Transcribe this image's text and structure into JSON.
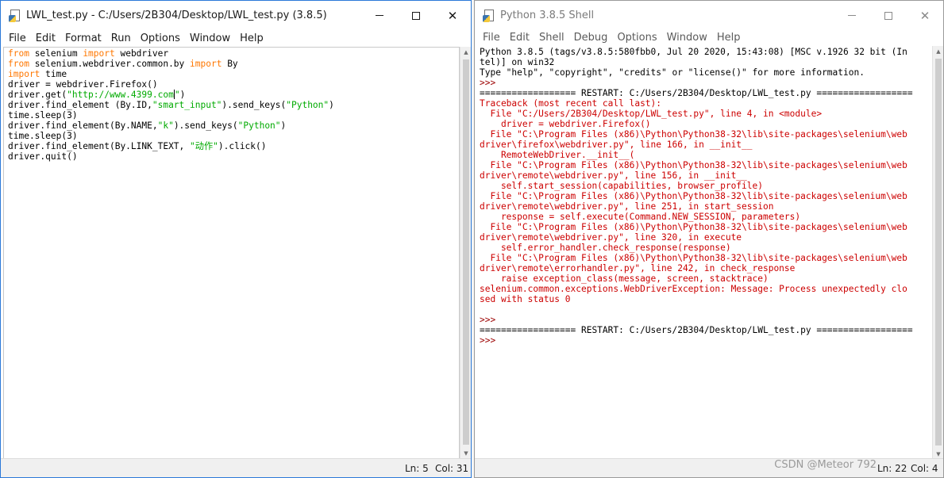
{
  "editor_window": {
    "title": "LWL_test.py - C:/Users/2B304/Desktop/LWL_test.py (3.8.5)",
    "menu": [
      "File",
      "Edit",
      "Format",
      "Run",
      "Options",
      "Window",
      "Help"
    ],
    "code_lines": [
      [
        {
          "t": "from",
          "c": "kw"
        },
        {
          "t": " selenium ",
          "c": ""
        },
        {
          "t": "import",
          "c": "kw"
        },
        {
          "t": " webdriver",
          "c": ""
        }
      ],
      [
        {
          "t": "from",
          "c": "kw"
        },
        {
          "t": " selenium.webdriver.common.by ",
          "c": ""
        },
        {
          "t": "import",
          "c": "kw"
        },
        {
          "t": " By",
          "c": ""
        }
      ],
      [
        {
          "t": "import",
          "c": "kw"
        },
        {
          "t": " time",
          "c": ""
        }
      ],
      [
        {
          "t": "driver = webdriver.Firefox()",
          "c": ""
        }
      ],
      [
        {
          "t": "driver.get(",
          "c": ""
        },
        {
          "t": "\"http://www.4399.com",
          "c": "str"
        },
        {
          "t": "|",
          "c": "cursor"
        },
        {
          "t": "\"",
          "c": "str"
        },
        {
          "t": ")",
          "c": ""
        }
      ],
      [
        {
          "t": "driver.find_element (By.ID,",
          "c": ""
        },
        {
          "t": "\"smart_input\"",
          "c": "str"
        },
        {
          "t": ").send_keys(",
          "c": ""
        },
        {
          "t": "\"Python\"",
          "c": "str"
        },
        {
          "t": ")",
          "c": ""
        }
      ],
      [
        {
          "t": "time.sleep(3)",
          "c": ""
        }
      ],
      [
        {
          "t": "driver.find_element(By.NAME,",
          "c": ""
        },
        {
          "t": "\"k\"",
          "c": "str"
        },
        {
          "t": ").send_keys(",
          "c": ""
        },
        {
          "t": "\"Python\"",
          "c": "str"
        },
        {
          "t": ")",
          "c": ""
        }
      ],
      [
        {
          "t": "time.sleep(3)",
          "c": ""
        }
      ],
      [
        {
          "t": "driver.find_element(By.LINK_TEXT, ",
          "c": ""
        },
        {
          "t": "\"动作\"",
          "c": "str"
        },
        {
          "t": ").click()",
          "c": ""
        }
      ],
      [
        {
          "t": "driver.quit()",
          "c": ""
        }
      ]
    ],
    "status": {
      "line": "Ln: 5",
      "col": "Col: 31"
    }
  },
  "shell_window": {
    "title": "Python 3.8.5 Shell",
    "menu": [
      "File",
      "Edit",
      "Shell",
      "Debug",
      "Options",
      "Window",
      "Help"
    ],
    "lines": [
      {
        "t": "Python 3.8.5 (tags/v3.8.5:580fbb0, Jul 20 2020, 15:43:08) [MSC v.1926 32 bit (In",
        "c": ""
      },
      {
        "t": "tel)] on win32",
        "c": ""
      },
      {
        "t": "Type \"help\", \"copyright\", \"credits\" or \"license()\" for more information.",
        "c": ""
      },
      {
        "t": ">>> ",
        "c": "prompt"
      },
      {
        "t": "================== RESTART: C:/Users/2B304/Desktop/LWL_test.py ==================",
        "c": ""
      },
      {
        "t": "Traceback (most recent call last):",
        "c": "err"
      },
      {
        "t": "  File \"C:/Users/2B304/Desktop/LWL_test.py\", line 4, in <module>",
        "c": "err"
      },
      {
        "t": "    driver = webdriver.Firefox()",
        "c": "err"
      },
      {
        "t": "  File \"C:\\Program Files (x86)\\Python\\Python38-32\\lib\\site-packages\\selenium\\web",
        "c": "err"
      },
      {
        "t": "driver\\firefox\\webdriver.py\", line 166, in __init__",
        "c": "err"
      },
      {
        "t": "    RemoteWebDriver.__init__(",
        "c": "err"
      },
      {
        "t": "  File \"C:\\Program Files (x86)\\Python\\Python38-32\\lib\\site-packages\\selenium\\web",
        "c": "err"
      },
      {
        "t": "driver\\remote\\webdriver.py\", line 156, in __init__",
        "c": "err"
      },
      {
        "t": "    self.start_session(capabilities, browser_profile)",
        "c": "err"
      },
      {
        "t": "  File \"C:\\Program Files (x86)\\Python\\Python38-32\\lib\\site-packages\\selenium\\web",
        "c": "err"
      },
      {
        "t": "driver\\remote\\webdriver.py\", line 251, in start_session",
        "c": "err"
      },
      {
        "t": "    response = self.execute(Command.NEW_SESSION, parameters)",
        "c": "err"
      },
      {
        "t": "  File \"C:\\Program Files (x86)\\Python\\Python38-32\\lib\\site-packages\\selenium\\web",
        "c": "err"
      },
      {
        "t": "driver\\remote\\webdriver.py\", line 320, in execute",
        "c": "err"
      },
      {
        "t": "    self.error_handler.check_response(response)",
        "c": "err"
      },
      {
        "t": "  File \"C:\\Program Files (x86)\\Python\\Python38-32\\lib\\site-packages\\selenium\\web",
        "c": "err"
      },
      {
        "t": "driver\\remote\\errorhandler.py\", line 242, in check_response",
        "c": "err"
      },
      {
        "t": "    raise exception_class(message, screen, stacktrace)",
        "c": "err"
      },
      {
        "t": "selenium.common.exceptions.WebDriverException: Message: Process unexpectedly clo",
        "c": "err"
      },
      {
        "t": "sed with status 0",
        "c": "err"
      },
      {
        "t": "",
        "c": ""
      },
      {
        "t": ">>> ",
        "c": "prompt"
      },
      {
        "t": "================== RESTART: C:/Users/2B304/Desktop/LWL_test.py ==================",
        "c": ""
      },
      {
        "t": ">>> ",
        "c": "prompt"
      }
    ],
    "status": {
      "line": "Ln: 22",
      "col": "Col: 4"
    }
  },
  "watermark": "CSDN @Meteor 792",
  "colors": {
    "keyword": "#ff7700",
    "string": "#00aa00",
    "error": "#cc0000",
    "prompt": "#9c0000"
  }
}
